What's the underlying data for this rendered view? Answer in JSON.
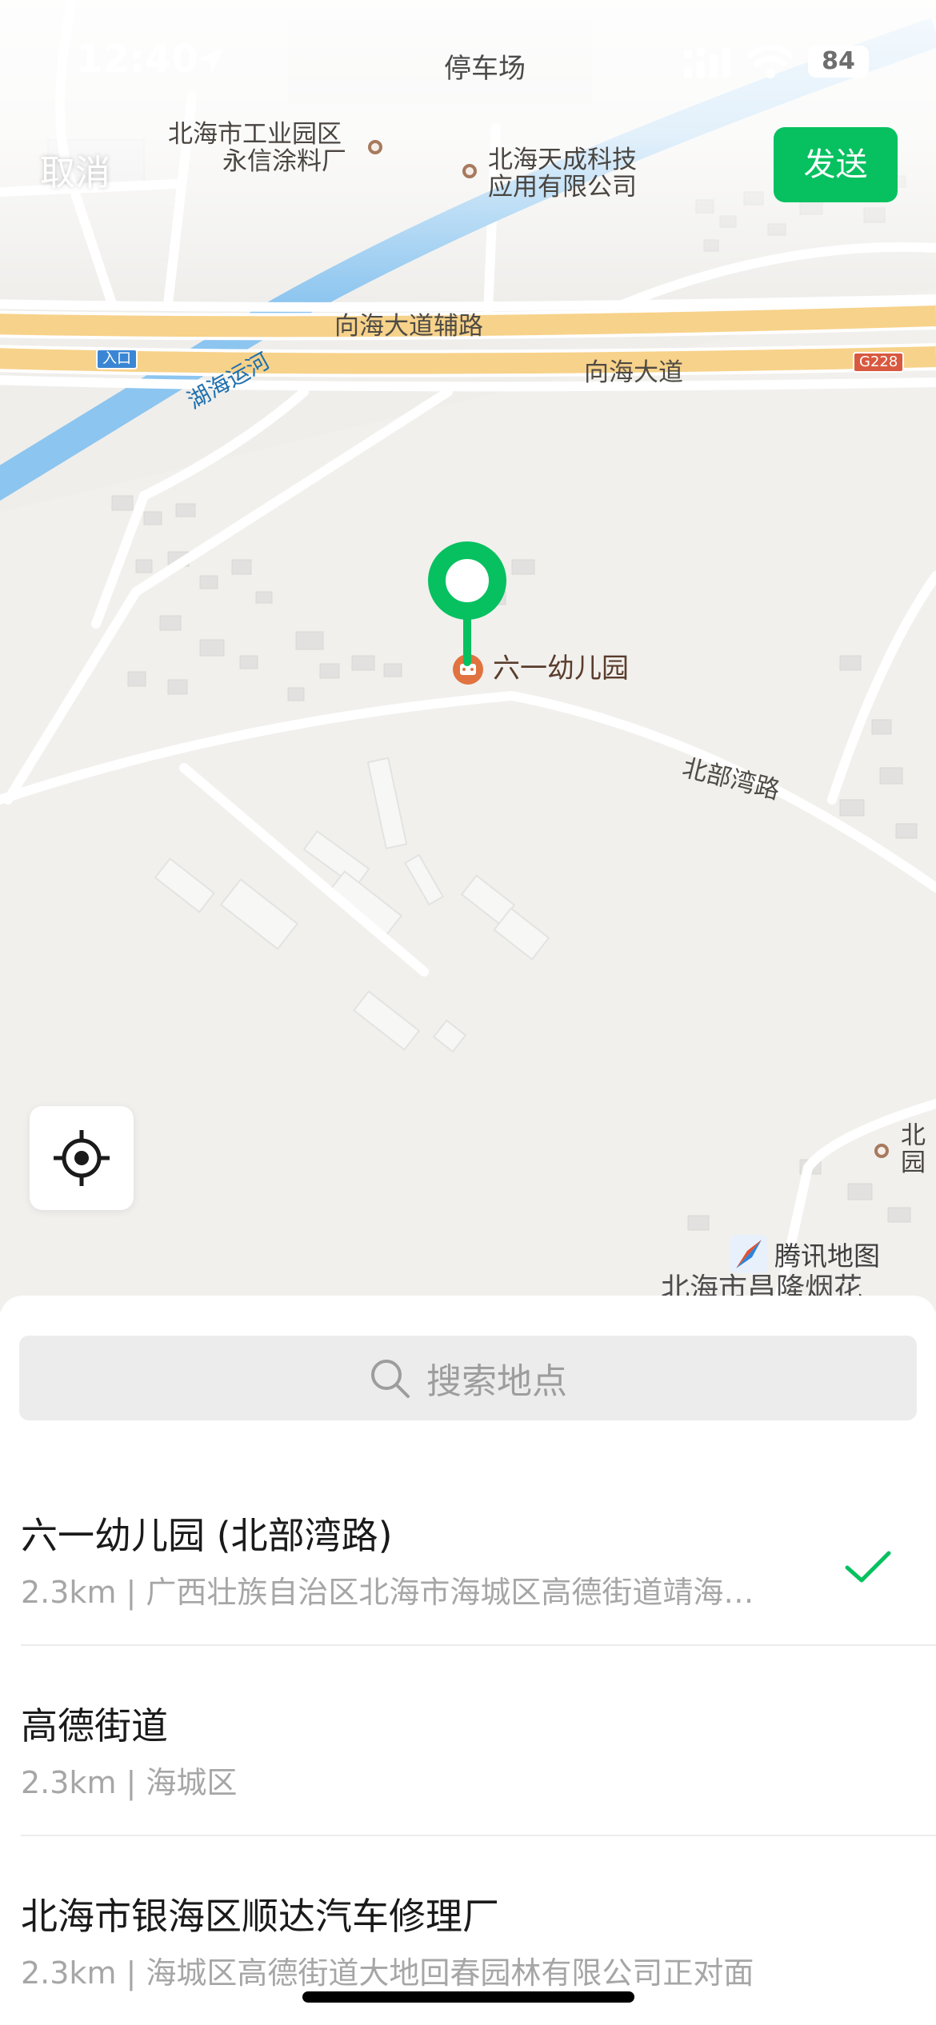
{
  "status_bar": {
    "time": "12:40",
    "center_label": "停车场",
    "battery": "84"
  },
  "header": {
    "cancel_label": "取消",
    "send_label": "发送"
  },
  "map": {
    "labels": {
      "poi_industrial": "北海市工业园区\n永信涂料厂",
      "poi_industrial_1": "北海市工业园区",
      "poi_industrial_2": "永信涂料厂",
      "poi_tech_1": "北海天成科技",
      "poi_tech_2": "应用有限公司",
      "road_aux": "向海大道辅路",
      "road_main": "向海大道",
      "canal": "湖海运河",
      "entry_sign": "入口",
      "hwy_sign": "G228",
      "kindergarten": "六一幼儿园",
      "road_beibu": "北部湾路",
      "edge_poi_1": "北",
      "edge_poi_2": "园",
      "bottom_partial": "北海市昌隆烟花"
    },
    "attribution": "腾讯地图",
    "icons": [
      "location-arrow-icon",
      "signal-icon",
      "wifi-icon",
      "pin-icon",
      "locate-icon",
      "tencent-map-logo-icon"
    ]
  },
  "sheet": {
    "search_placeholder": "搜索地点",
    "results": [
      {
        "title": "六一幼儿园 (北部湾路)",
        "subtitle": "2.3km | 广西壮族自治区北海市海城区高德街道靖海…",
        "selected": true
      },
      {
        "title": "高德街道",
        "subtitle": "2.3km | 海城区",
        "selected": false
      },
      {
        "title": "北海市银海区顺达汽车修理厂",
        "subtitle": "2.3km | 海城区高德街道大地回春园林有限公司正对面",
        "selected": false
      }
    ]
  },
  "colors": {
    "accent": "#07c160",
    "map_bg": "#f1f0ed",
    "highway": "#f7d28a",
    "canal": "#8cc5ef"
  }
}
